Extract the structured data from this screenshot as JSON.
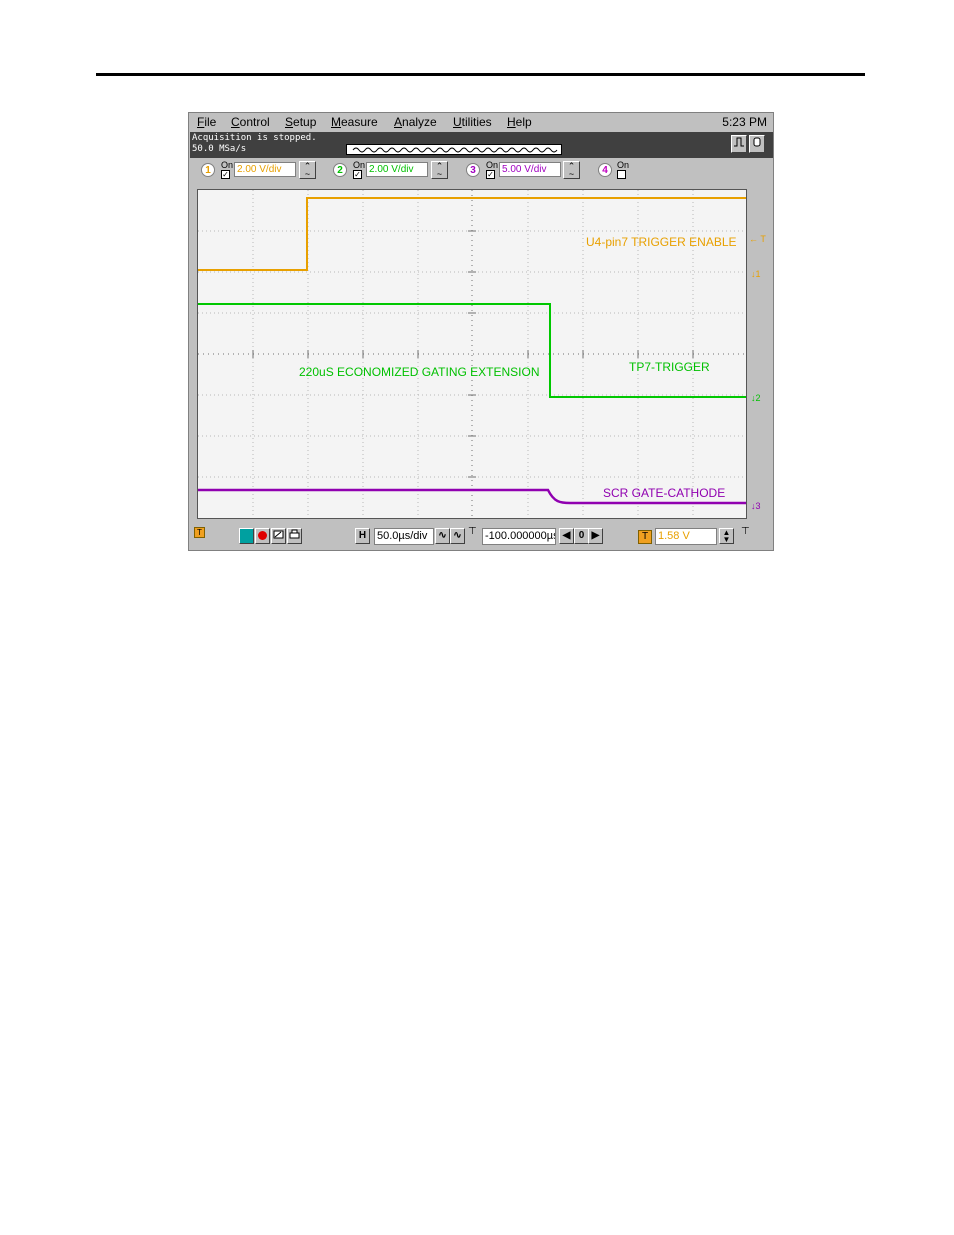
{
  "menu": {
    "items": [
      "File",
      "Control",
      "Setup",
      "Measure",
      "Analyze",
      "Utilities",
      "Help"
    ],
    "clock": "5:23 PM"
  },
  "status": {
    "line1": "Acquisition is stopped.",
    "line2": "50.0 MSa/s"
  },
  "channels": [
    {
      "num": "1",
      "on_label": "On",
      "scale": "2.00 V/div",
      "color": "#e8a000"
    },
    {
      "num": "2",
      "on_label": "On",
      "scale": "2.00 V/div",
      "color": "#00c000"
    },
    {
      "num": "3",
      "on_label": "On",
      "scale": "5.00 V/div",
      "color": "#a000c0"
    },
    {
      "num": "4",
      "on_label": "On",
      "scale": "",
      "color": "#c000c0"
    }
  ],
  "traces": {
    "ch1_label": "U4-pin7 TRIGGER ENABLE",
    "ch2_label": "TP7-TRIGGER",
    "ch3_label": "SCR GATE-CATHODE",
    "annotation": "220uS ECONOMIZED GATING EXTENSION",
    "trigger_marker": "T",
    "ch1_marker": "1",
    "ch2_marker": "2",
    "ch3_marker": "3"
  },
  "bottom": {
    "h_label": "H",
    "timebase": "50.0µs/div",
    "delay": "-100.000000µs",
    "zero_label": "0",
    "trig_icon": "T",
    "trig_level": "1.58 V"
  },
  "colors": {
    "ch1": "#e8a000",
    "ch2": "#00c000",
    "ch3": "#9000b0",
    "status_bg": "#404040"
  }
}
